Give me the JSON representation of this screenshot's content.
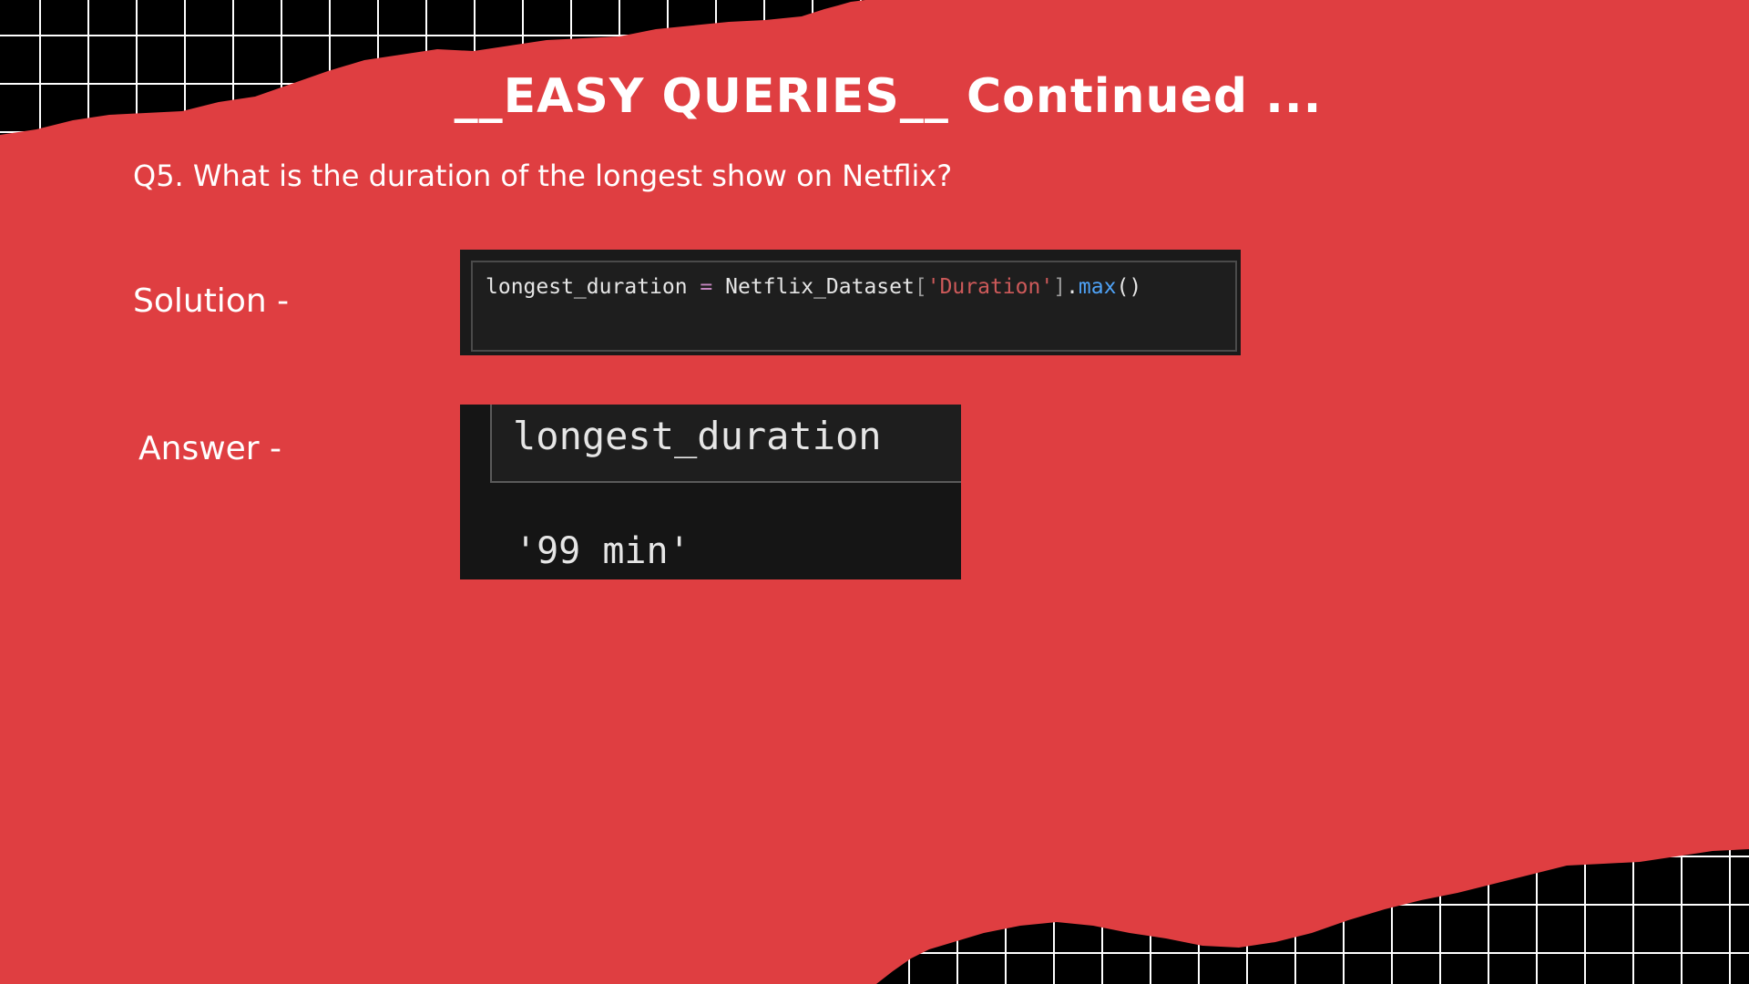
{
  "slide": {
    "title": "__EASY QUERIES__ Continued ...",
    "question": "Q5. What is the duration of the longest show on Netflix?"
  },
  "solution": {
    "label": "Solution -",
    "code": {
      "var": "longest_duration",
      "op": "=",
      "object": "Netflix_Dataset",
      "open_bracket": "[",
      "key": "'Duration'",
      "close_bracket": "]",
      "dot": ".",
      "method": "max",
      "parens": "()"
    }
  },
  "answer": {
    "label": "Answer -",
    "variable": "longest_duration",
    "value": "'99 min'"
  },
  "colors": {
    "paper": "#df3e41",
    "background": "#000000",
    "grid_lines": "#ffffff",
    "code_bg": "#1e1e1e",
    "string": "#ce5a5a",
    "function": "#4fa3f7",
    "operator": "#c586c0"
  }
}
